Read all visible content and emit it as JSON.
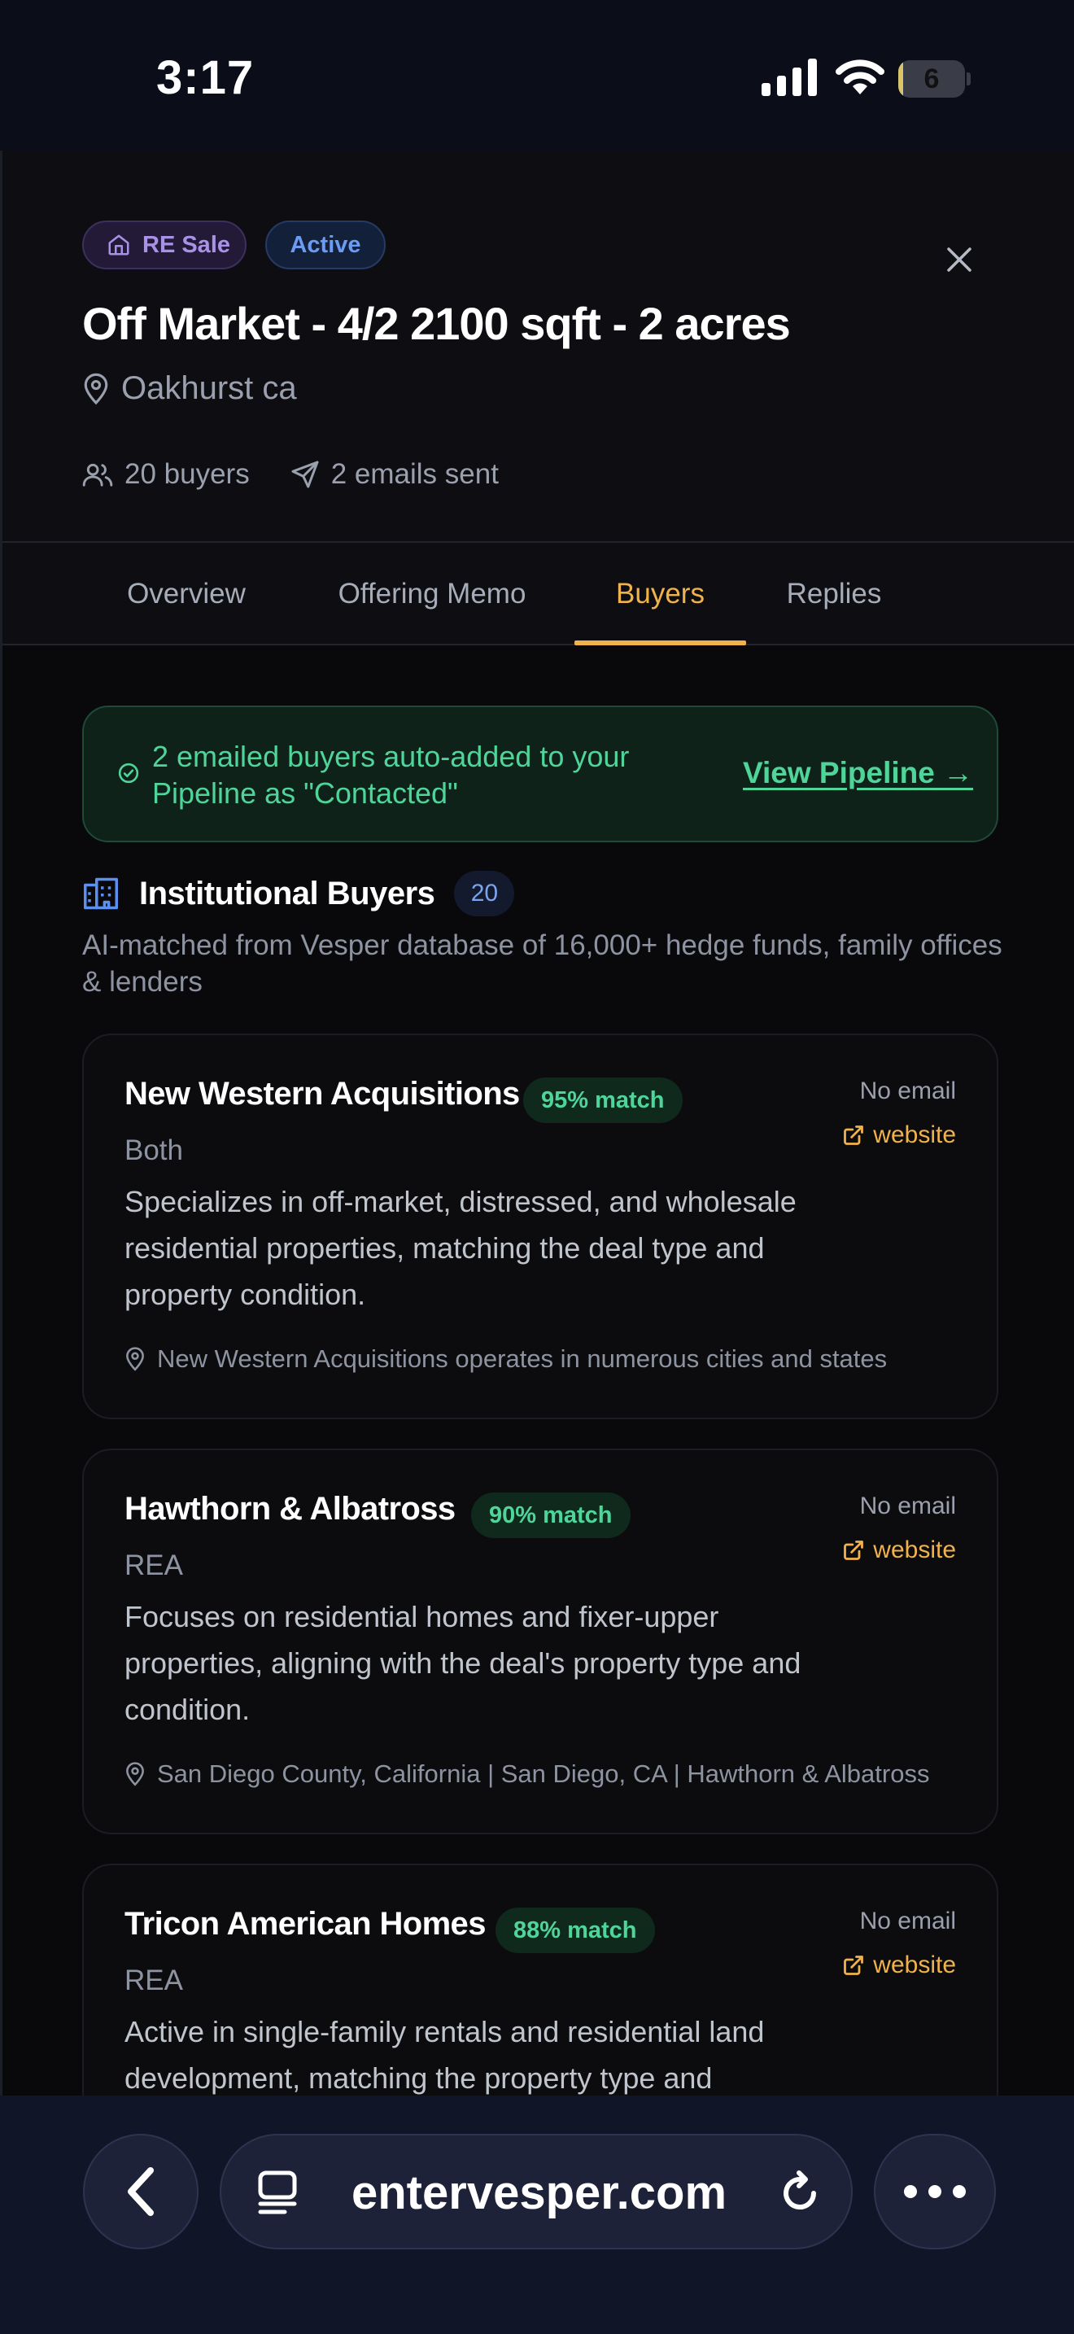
{
  "status_bar": {
    "time": "3:17",
    "battery": "6",
    "battery_level": 0.06
  },
  "listing": {
    "type_badge": "RE Sale",
    "status_badge": "Active",
    "title": "Off Market - 4/2 2100 sqft - 2 acres",
    "location": "Oakhurst ca",
    "buyers_count": "20 buyers",
    "emails_sent": "2 emails sent"
  },
  "tabs": [
    {
      "label": "Overview",
      "active": false
    },
    {
      "label": "Offering Memo",
      "active": false
    },
    {
      "label": "Buyers",
      "active": true
    },
    {
      "label": "Replies",
      "active": false
    }
  ],
  "notice": {
    "text": "2 emailed buyers auto-added to your Pipeline as \"Contacted\"",
    "link": "View Pipeline →"
  },
  "section": {
    "title": "Institutional Buyers",
    "count": "20",
    "description": "AI-matched from Vesper database of 16,000+ hedge funds, family offices & lenders"
  },
  "buyers": [
    {
      "name": "New Western Acquisitions",
      "match": "95% match",
      "type": "Both",
      "email": "No email",
      "website": "website",
      "description": "Specializes in off-market, distressed, and wholesale residential properties, matching the deal type and property condition.",
      "location": "New Western Acquisitions operates in numerous cities and states"
    },
    {
      "name": "Hawthorn & Albatross",
      "match": "90% match",
      "type": "REA",
      "email": "No email",
      "website": "website",
      "description": "Focuses on residential homes and fixer-upper properties, aligning with the deal's property type and condition.",
      "location": "San Diego County, California | San Diego, CA | Hawthorn & Albatross"
    },
    {
      "name": "Tricon American Homes",
      "match": "88% match",
      "type": "REA",
      "email": "No email",
      "website": "website",
      "description": "Active in single-family rentals and residential land development, matching the property type and",
      "location": ""
    }
  ],
  "browser": {
    "url": "entervesper.com"
  },
  "colors": {
    "accent": "#f0b24a",
    "success": "#4fd59a",
    "info": "#6b9bf2",
    "purple": "#a892e8"
  }
}
